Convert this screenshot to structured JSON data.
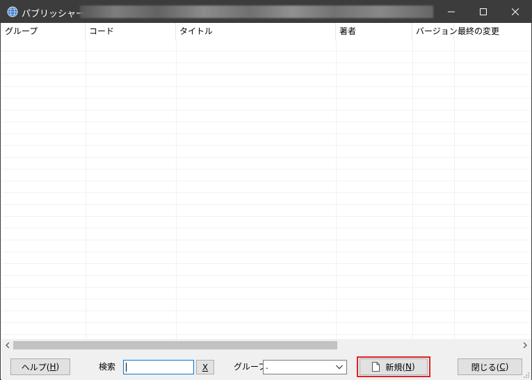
{
  "window": {
    "title": "パブリッシャー",
    "title_suffix_blurred": true,
    "controls": {
      "minimize_glyph": "—",
      "maximize_glyph": "☐",
      "close_glyph": "✕"
    }
  },
  "grid": {
    "columns": [
      "グループ",
      "コード",
      "タイトル",
      "著者",
      "バージョン",
      "最終の変更"
    ],
    "rows": []
  },
  "scrollbar": {
    "left_arrow": "‹",
    "right_arrow": "›"
  },
  "bottombar": {
    "help_label": "ヘルプ(",
    "help_key": "H",
    "search_label": "検索",
    "search_value": "",
    "clear_label": "X",
    "group_label": "グループ",
    "group_value": ".",
    "new_label_prefix": "新規(",
    "new_key": "N",
    "close_label": "閉じる(",
    "close_key": "C",
    "paren_close": ")"
  },
  "colors": {
    "titlebar": "#3c3c3c",
    "highlight": "#e02020",
    "bottombar_bg": "#f0f0f0"
  }
}
